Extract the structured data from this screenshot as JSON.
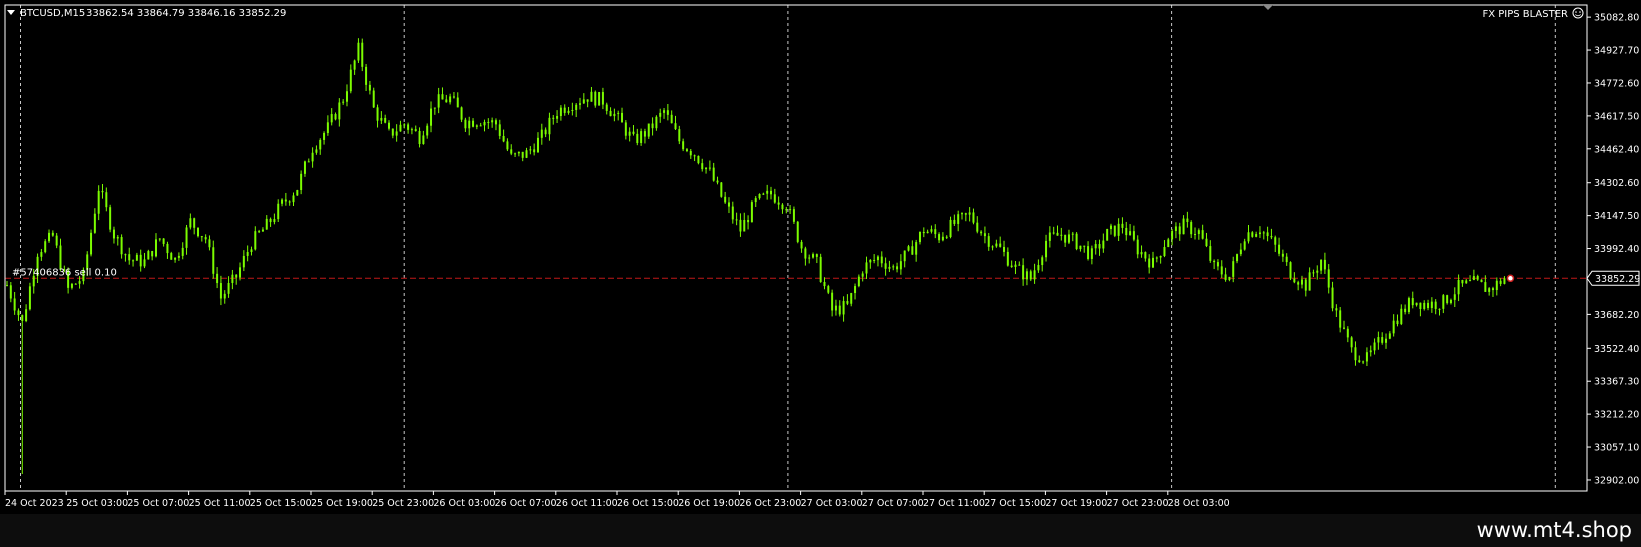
{
  "header": {
    "symbol": "BTCUSD,M15",
    "ohlc": "33862.54 33864.79 33846.16 33852.29",
    "indicator_label": "FX PIPS BLASTER"
  },
  "order_line": {
    "label": "#57406836 sell 0.10",
    "price": 33852.29
  },
  "price_marker": "33852.29",
  "watermark": "www.mt4.shop",
  "colors": {
    "background": "#000000",
    "candle": "#7CFC00",
    "grid": "#c8c8c8",
    "order_line": "#c01818",
    "text": "#ffffff"
  },
  "chart_data": {
    "type": "candlestick",
    "timeframe": "M15",
    "ylim": [
      32850,
      35140
    ],
    "y_ticks": [
      35082.8,
      34927.7,
      34772.6,
      34617.5,
      34462.4,
      34302.6,
      34147.5,
      33992.4,
      33852.29,
      33682.2,
      33522.4,
      33367.3,
      33212.2,
      33057.1,
      32902.0
    ],
    "x_ticks": [
      "24 Oct 2023",
      "25 Oct 03:00",
      "25 Oct 07:00",
      "25 Oct 11:00",
      "25 Oct 15:00",
      "25 Oct 19:00",
      "25 Oct 23:00",
      "26 Oct 03:00",
      "26 Oct 07:00",
      "26 Oct 11:00",
      "26 Oct 15:00",
      "26 Oct 19:00",
      "26 Oct 23:00",
      "27 Oct 03:00",
      "27 Oct 07:00",
      "27 Oct 11:00",
      "27 Oct 15:00",
      "27 Oct 19:00",
      "27 Oct 23:00",
      "28 Oct 03:00"
    ],
    "bars_per_tick": 16,
    "grid": "vertical dashed every 24 bars",
    "close_path": [
      [
        0,
        33820
      ],
      [
        4,
        33640
      ],
      [
        8,
        33980
      ],
      [
        12,
        34050
      ],
      [
        16,
        33800
      ],
      [
        20,
        33860
      ],
      [
        24,
        34280
      ],
      [
        28,
        34060
      ],
      [
        32,
        33940
      ],
      [
        36,
        33930
      ],
      [
        40,
        34040
      ],
      [
        44,
        33940
      ],
      [
        48,
        34120
      ],
      [
        52,
        34040
      ],
      [
        56,
        33760
      ],
      [
        60,
        33860
      ],
      [
        64,
        34020
      ],
      [
        68,
        34100
      ],
      [
        72,
        34200
      ],
      [
        76,
        34280
      ],
      [
        80,
        34470
      ],
      [
        84,
        34560
      ],
      [
        88,
        34700
      ],
      [
        92,
        34930
      ],
      [
        96,
        34650
      ],
      [
        100,
        34530
      ],
      [
        104,
        34580
      ],
      [
        108,
        34520
      ],
      [
        112,
        34680
      ],
      [
        116,
        34700
      ],
      [
        120,
        34590
      ],
      [
        124,
        34600
      ],
      [
        128,
        34580
      ],
      [
        132,
        34420
      ],
      [
        136,
        34440
      ],
      [
        140,
        34520
      ],
      [
        144,
        34640
      ],
      [
        148,
        34680
      ],
      [
        152,
        34710
      ],
      [
        156,
        34690
      ],
      [
        160,
        34600
      ],
      [
        164,
        34500
      ],
      [
        168,
        34550
      ],
      [
        172,
        34640
      ],
      [
        176,
        34500
      ],
      [
        180,
        34440
      ],
      [
        184,
        34350
      ],
      [
        188,
        34200
      ],
      [
        192,
        34080
      ],
      [
        196,
        34210
      ],
      [
        200,
        34250
      ],
      [
        204,
        34200
      ],
      [
        208,
        34000
      ],
      [
        212,
        33920
      ],
      [
        216,
        33700
      ],
      [
        220,
        33720
      ],
      [
        224,
        33900
      ],
      [
        228,
        33950
      ],
      [
        232,
        33900
      ],
      [
        236,
        33970
      ],
      [
        240,
        34080
      ],
      [
        244,
        34050
      ],
      [
        248,
        34110
      ],
      [
        252,
        34150
      ],
      [
        256,
        34050
      ],
      [
        260,
        33990
      ],
      [
        264,
        33900
      ],
      [
        268,
        33850
      ],
      [
        272,
        34030
      ],
      [
        276,
        34060
      ],
      [
        280,
        34020
      ],
      [
        284,
        33960
      ],
      [
        288,
        34060
      ],
      [
        292,
        34100
      ],
      [
        296,
        33990
      ],
      [
        300,
        33920
      ],
      [
        304,
        34050
      ],
      [
        308,
        34100
      ],
      [
        312,
        34070
      ],
      [
        316,
        33900
      ],
      [
        320,
        33860
      ],
      [
        324,
        34060
      ],
      [
        328,
        34090
      ],
      [
        332,
        34000
      ],
      [
        336,
        33880
      ],
      [
        340,
        33820
      ],
      [
        344,
        33940
      ],
      [
        348,
        33680
      ],
      [
        352,
        33510
      ],
      [
        356,
        33470
      ],
      [
        360,
        33570
      ],
      [
        364,
        33670
      ],
      [
        368,
        33750
      ],
      [
        372,
        33730
      ],
      [
        376,
        33740
      ],
      [
        380,
        33810
      ],
      [
        384,
        33830
      ],
      [
        388,
        33800
      ],
      [
        392,
        33852.29
      ]
    ]
  }
}
